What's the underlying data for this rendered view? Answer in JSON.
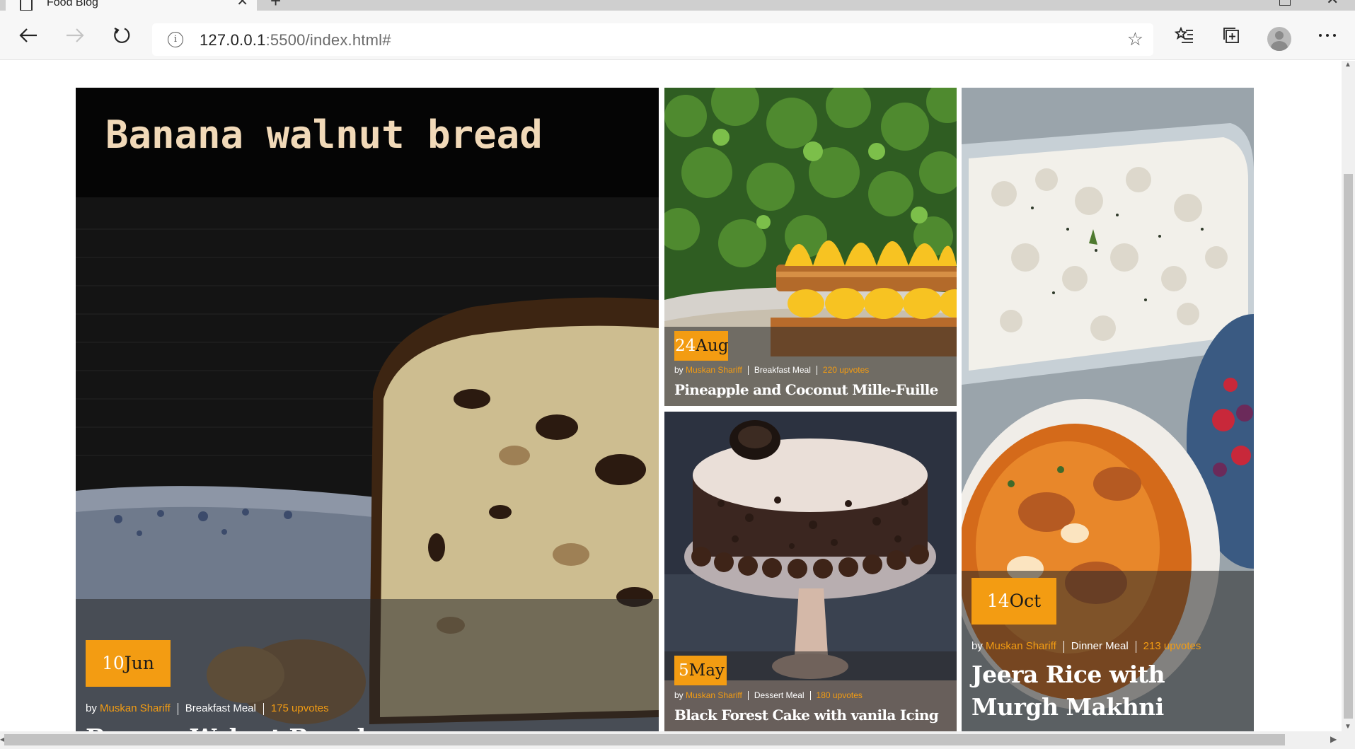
{
  "browser": {
    "tab_title": "Food Blog",
    "url_host": "127.0.0.1",
    "url_path": ":5500/index.html#"
  },
  "cards": [
    {
      "art_text": "Banana walnut bread",
      "date_day": "10",
      "date_month": "Jun",
      "by": "by",
      "author": "Muskan Shariff",
      "category": "Breakfast Meal",
      "upvotes": "175 upvotes",
      "title": "Banana Walnut Bread"
    },
    {
      "date_day": "24",
      "date_month": "Aug",
      "by": "by",
      "author": "Muskan Shariff",
      "category": "Breakfast Meal",
      "upvotes": "220 upvotes",
      "title": "Pineapple and Coconut Mille-Fuille"
    },
    {
      "date_day": "5",
      "date_month": "May",
      "by": "by",
      "author": "Muskan Shariff",
      "category": "Dessert Meal",
      "upvotes": "180 upvotes",
      "title": "Black Forest Cake with vanila Icing"
    },
    {
      "date_day": "14",
      "date_month": "Oct",
      "by": "by",
      "author": "Muskan Shariff",
      "category": "Dinner Meal",
      "upvotes": "213 upvotes",
      "title": "Jeera Rice with Murgh Makhni"
    }
  ],
  "colors": {
    "accent": "#f39c12",
    "chrome_bg": "#f7f7f7",
    "tab_strip": "#cfcfcf"
  },
  "icons": [
    "page-icon",
    "close-icon",
    "plus-icon",
    "back-arrow-icon",
    "forward-arrow-icon",
    "refresh-icon",
    "info-icon",
    "star-icon",
    "favorites-icon",
    "collections-icon",
    "profile-icon",
    "more-icon"
  ]
}
